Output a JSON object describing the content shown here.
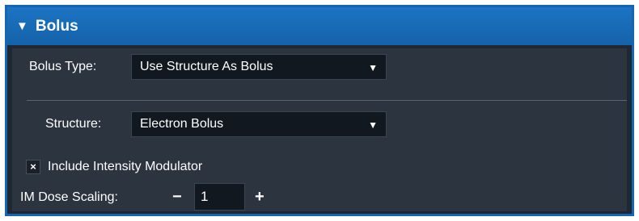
{
  "panel": {
    "expand_icon": "triangle-down-icon",
    "title": "Bolus"
  },
  "bolus_type": {
    "label": "Bolus Type:",
    "value": "Use Structure As Bolus",
    "arrow": "▼"
  },
  "structure": {
    "label": "Structure:",
    "value": "Electron Bolus",
    "arrow": "▼"
  },
  "include_im": {
    "checked": true,
    "mark": "×",
    "label": "Include Intensity Modulator"
  },
  "im_dose_scaling": {
    "label": "IM Dose Scaling:",
    "minus": "−",
    "value": "1",
    "plus": "+"
  },
  "colors": {
    "header": "#1565b0",
    "panel_bg": "#2c3440",
    "field_bg": "#111820",
    "text": "#ffffff"
  }
}
